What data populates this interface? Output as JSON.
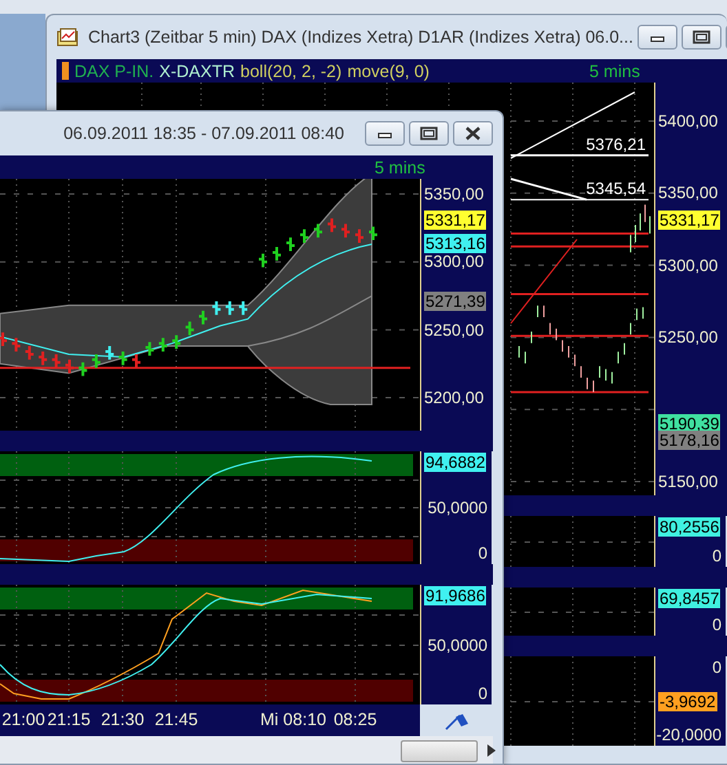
{
  "back_window": {
    "title": "Chart3 (Zeitbar 5 min)  DAX (Indizes Xetra) D1AR (Indizes Xetra) 06.0...",
    "legend": [
      {
        "text": "DAX P-IN.",
        "color": "#20b050"
      },
      {
        "text": "X-DAXTR",
        "color": "#b0f0d0"
      },
      {
        "text": "boll(20, 2, -2)",
        "color": "#d0d060"
      },
      {
        "text": "move(9, 0)",
        "color": "#d0d060"
      }
    ],
    "interval": "5 mins",
    "level_labels": [
      "5376,21",
      "5345,54"
    ],
    "price_axis": [
      {
        "text": "5400,00",
        "kind": "tick"
      },
      {
        "text": "5350,00",
        "kind": "tick"
      },
      {
        "text": "5331,17",
        "kind": "tag",
        "color": "#ffff30"
      },
      {
        "text": "5300,00",
        "kind": "tick"
      },
      {
        "text": "5250,00",
        "kind": "tick"
      },
      {
        "text": "5190,39",
        "kind": "tag",
        "color": "#40e0a0"
      },
      {
        "text": "5178,16",
        "kind": "tag",
        "color": "#808080"
      },
      {
        "text": "5150,00",
        "kind": "tick"
      }
    ],
    "panels": [
      {
        "labels": [
          {
            "text": "80,2556",
            "kind": "tag",
            "color": "#40f0e0"
          },
          {
            "text": "0",
            "kind": "tick"
          }
        ]
      },
      {
        "labels": [
          {
            "text": "69,8457",
            "kind": "tag",
            "color": "#40f0e0"
          },
          {
            "text": "0",
            "kind": "tick"
          }
        ]
      },
      {
        "labels": [
          {
            "text": "0",
            "kind": "tick"
          },
          {
            "text": "-3,9692",
            "kind": "tag",
            "color": "#ffa020"
          },
          {
            "text": "-20,0000",
            "kind": "tick"
          }
        ]
      }
    ]
  },
  "front_window": {
    "title": "06.09.2011 18:35 - 07.09.2011 08:40",
    "interval": "5 mins",
    "price_axis": [
      {
        "text": "5350,00",
        "kind": "tick"
      },
      {
        "text": "5331,17",
        "kind": "tag",
        "color": "#ffff30"
      },
      {
        "text": "5313,16",
        "kind": "tag",
        "color": "#40f0f0"
      },
      {
        "text": "5300,00",
        "kind": "tick"
      },
      {
        "text": "5271,39",
        "kind": "tag",
        "color": "#808080"
      },
      {
        "text": "5250,00",
        "kind": "tick"
      },
      {
        "text": "5200,00",
        "kind": "tick"
      }
    ],
    "panels": [
      {
        "labels": [
          {
            "text": "94,6882",
            "kind": "tag",
            "color": "#40f0f0"
          },
          {
            "text": "50,0000",
            "kind": "tick"
          },
          {
            "text": "0",
            "kind": "tick"
          }
        ]
      },
      {
        "labels": [
          {
            "text": "91,9686",
            "kind": "tag",
            "color": "#40f0f0"
          },
          {
            "text": "50,0000",
            "kind": "tick"
          },
          {
            "text": "0",
            "kind": "tick"
          }
        ]
      }
    ],
    "time_axis": [
      "21:00",
      "21:15",
      "21:30",
      "21:45",
      "Mi 08:10",
      "08:25"
    ]
  }
}
